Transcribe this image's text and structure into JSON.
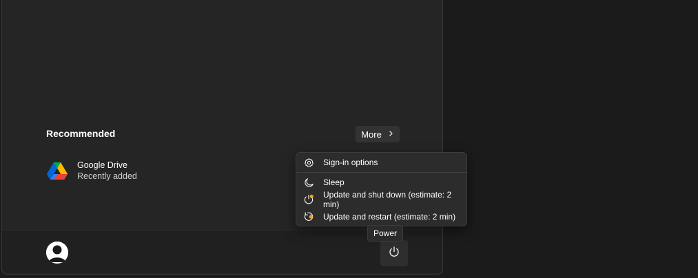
{
  "recommended": {
    "title": "Recommended",
    "more_label": "More",
    "items": [
      {
        "name": "Google Drive",
        "subtitle": "Recently added",
        "icon": "google-drive-icon"
      }
    ]
  },
  "power_menu": {
    "items": [
      {
        "label": "Sign-in options",
        "icon": "gear-icon"
      },
      {
        "label": "Sleep",
        "icon": "moon-icon"
      },
      {
        "label": "Update and shut down (estimate: 2 min)",
        "icon": "update-shutdown-icon"
      },
      {
        "label": "Update and restart (estimate: 2 min)",
        "icon": "update-restart-icon"
      }
    ]
  },
  "footer": {
    "avatar_icon": "user-avatar-icon",
    "power_icon": "power-icon",
    "power_tooltip": "Power"
  },
  "colors": {
    "background": "#1b1b1b",
    "menu_background": "#252525",
    "flyout_background": "#2c2c2c",
    "update_badge": "#f7a21b"
  }
}
